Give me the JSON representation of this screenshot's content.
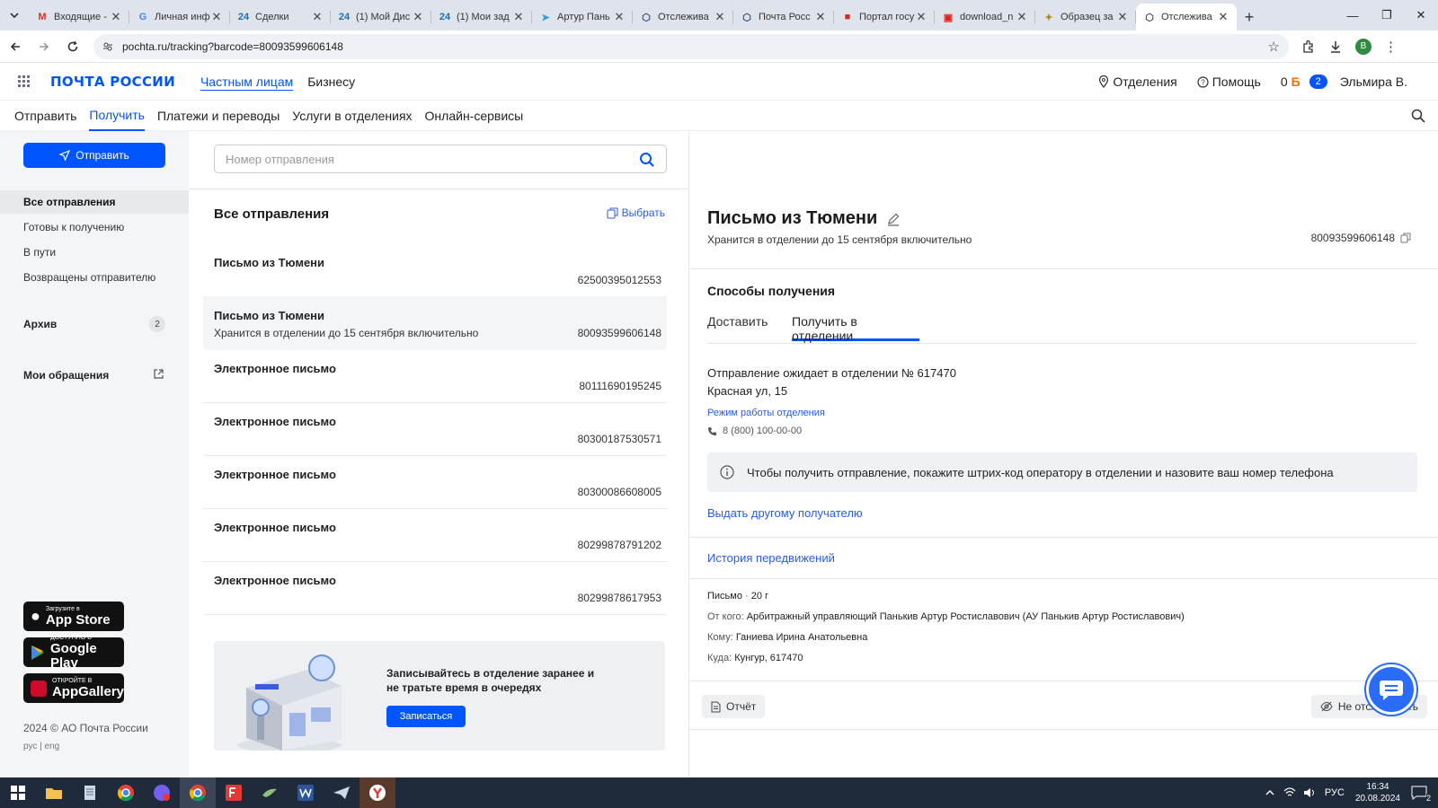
{
  "browser": {
    "tabs": [
      {
        "title": "Входящие -",
        "icon": "gmail-icon",
        "glyph": "M",
        "color": "#d93025"
      },
      {
        "title": "Личная инф",
        "icon": "google-icon",
        "glyph": "G",
        "color": "#4285f4"
      },
      {
        "title": "Сделки",
        "icon": "bitrix24-icon",
        "glyph": "24",
        "color": "#1e6fb5"
      },
      {
        "title": "(1) Мой Дис",
        "icon": "bitrix24-icon",
        "glyph": "24",
        "color": "#1e6fb5"
      },
      {
        "title": "(1) Мои зад",
        "icon": "bitrix24-icon",
        "glyph": "24",
        "color": "#1e6fb5"
      },
      {
        "title": "Артур Пань",
        "icon": "telegram-icon",
        "glyph": "➤",
        "color": "#2aa1da"
      },
      {
        "title": "Отслежива",
        "icon": "package-icon",
        "glyph": "⬡",
        "color": "#3c4a7a"
      },
      {
        "title": "Почта Росс",
        "icon": "package-icon",
        "glyph": "⬡",
        "color": "#3c4a7a"
      },
      {
        "title": "Портал госу",
        "icon": "russia-flag-icon",
        "glyph": "■",
        "color": "#d52b1e"
      },
      {
        "title": "download_n",
        "icon": "pdf-icon",
        "glyph": "▣",
        "color": "#e2231a"
      },
      {
        "title": "Образец за",
        "icon": "coat-of-arms-icon",
        "glyph": "✦",
        "color": "#b8860b"
      },
      {
        "title": "Отслежива",
        "icon": "package-icon",
        "glyph": "⬡",
        "color": "#3c4a7a",
        "active": true
      }
    ],
    "url": "pochta.ru/tracking?barcode=80093599606148",
    "profile_letter": "В"
  },
  "header": {
    "logo": "ПОЧТА РОССИИ",
    "links": [
      "Частным лицам",
      "Бизнесу"
    ],
    "offices": "Отделения",
    "help": "Помощь",
    "balance": "0",
    "currency": "Б",
    "notifications": "2",
    "user": "Эльмира В."
  },
  "subnav": [
    "Отправить",
    "Получить",
    "Платежи и переводы",
    "Услуги в отделениях",
    "Онлайн-сервисы"
  ],
  "sidebar": {
    "send_button": "Отправить",
    "items": [
      "Все отправления",
      "Готовы к получению",
      "В пути",
      "Возвращены отправителю"
    ],
    "archive": "Архив",
    "archive_count": "2",
    "appeals": "Мои обращения",
    "stores": [
      {
        "small": "Загрузите в",
        "big": "App Store"
      },
      {
        "small": "ДОСТУПНО В",
        "big": "Google Play"
      },
      {
        "small": "ОТКРОЙТЕ В",
        "big": "AppGallery"
      }
    ],
    "copyright": "2024 © АО Почта России",
    "langs": "рус | eng"
  },
  "list": {
    "search_placeholder": "Номер отправления",
    "title": "Все отправления",
    "select": "Выбрать",
    "items": [
      {
        "name": "Письмо из Тюмени",
        "status": "",
        "barcode": "62500395012553"
      },
      {
        "name": "Письмо из Тюмени",
        "status": "Хранится в отделении до 15 сентября включительно",
        "barcode": "80093599606148",
        "selected": true
      },
      {
        "name": "Электронное письмо",
        "status": "",
        "barcode": "80111690195245"
      },
      {
        "name": "Электронное письмо",
        "status": "",
        "barcode": "80300187530571"
      },
      {
        "name": "Электронное письмо",
        "status": "",
        "barcode": "80300086608005"
      },
      {
        "name": "Электронное письмо",
        "status": "",
        "barcode": "80299878791202"
      },
      {
        "name": "Электронное письмо",
        "status": "",
        "barcode": "80299878617953"
      }
    ],
    "promo": {
      "text": "Записывайтесь в отделение заранее и не тратьте время в очередях",
      "button": "Записаться"
    }
  },
  "detail": {
    "title": "Письмо из Тюмени",
    "status": "Хранится в отделении до 15 сентября включительно",
    "barcode": "80093599606148",
    "methods_title": "Способы получения",
    "tabs": [
      "Доставить",
      "Получить в отделении"
    ],
    "awaiting": "Отправление ожидает в отделении № 617470",
    "address": "Красная ул, 15",
    "hours_link": "Режим работы отделения",
    "phone": "8 (800) 100-00-00",
    "info": "Чтобы получить отправление, покажите штрих-код оператору в отделении и назовите ваш номер телефона",
    "other_recipient": "Выдать другому получателю",
    "history": "История передвижений",
    "type": "Письмо",
    "weight": "20 г",
    "from_label": "От кого:",
    "from": "Арбитражный управляющий Панькив Артур Ростиславович (АУ Панькив Артур Ростиславович)",
    "to_label": "Кому:",
    "to": "Ганиева Ирина Анатольевна",
    "where_label": "Куда:",
    "where": "Кунгур, 617470",
    "report": "Отчёт",
    "untrack": "Не отслеживать"
  },
  "taskbar": {
    "lang": "РУС",
    "time": "16:34",
    "date": "20.08.2024",
    "notif_count": "2"
  },
  "colors": {
    "accent": "#0055ff",
    "link": "#2b5ce6",
    "sidebar_bg": "#f4f5f7"
  }
}
